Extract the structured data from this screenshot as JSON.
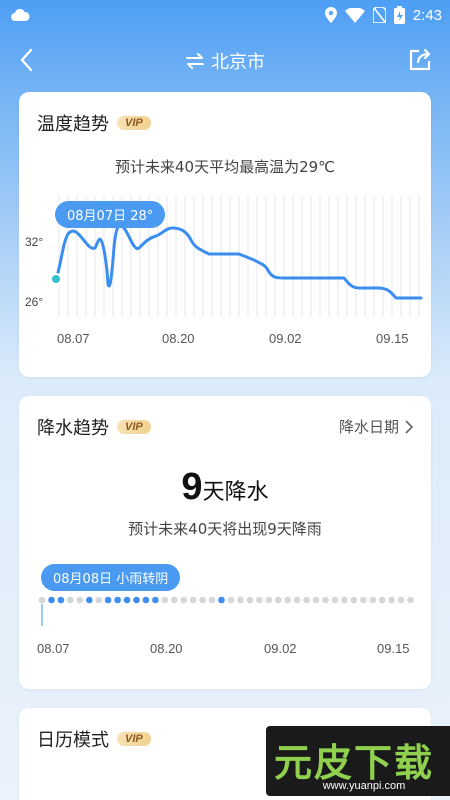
{
  "status_bar": {
    "time": "2:43"
  },
  "app_bar": {
    "city": "北京市"
  },
  "temperature_card": {
    "title": "温度趋势",
    "vip": "VIP",
    "subtitle": "预计未来40天平均最高温为29℃",
    "tooltip": "08月07日 28°",
    "y_labels": [
      "32°",
      "26°"
    ],
    "x_labels": [
      "08.07",
      "08.20",
      "09.02",
      "09.15"
    ]
  },
  "rain_card": {
    "title": "降水趋势",
    "vip": "VIP",
    "link": "降水日期",
    "rain_days": "9",
    "rain_days_unit": "天降水",
    "subtitle": "预计未来40天将出现9天降雨",
    "tooltip": "08月08日 小雨转阴",
    "x_labels": [
      "08.07",
      "08.20",
      "09.02",
      "09.15"
    ],
    "rain_flags": [
      0,
      1,
      1,
      0,
      0,
      1,
      0,
      1,
      1,
      1,
      1,
      1,
      1,
      0,
      0,
      0,
      0,
      0,
      0,
      1,
      0,
      0,
      0,
      0,
      0,
      0,
      0,
      0,
      0,
      0,
      0,
      0,
      0,
      0,
      0,
      0,
      0,
      0,
      0,
      0
    ]
  },
  "calendar_card": {
    "title": "日历模式",
    "vip": "VIP"
  },
  "watermark": {
    "logo": "元皮下载",
    "url": "www.yuanpi.com"
  },
  "colors": {
    "accent": "#4a9af2",
    "rain_dot": "#3d8ef0",
    "dry_dot": "#d3d7dc"
  }
}
